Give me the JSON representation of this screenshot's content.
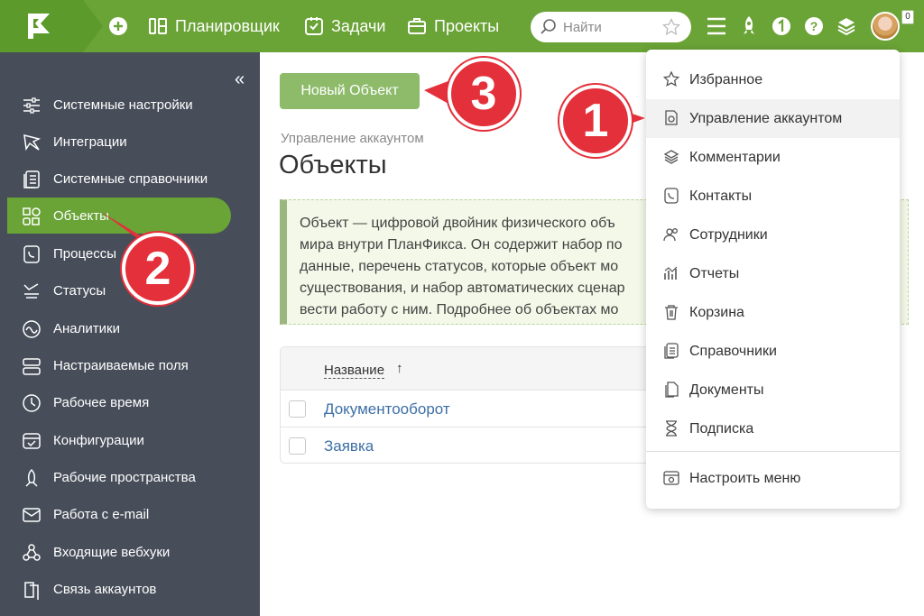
{
  "topbar": {
    "nav": [
      {
        "label": "Планировщик",
        "icon": "calendar-icon"
      },
      {
        "label": "Задачи",
        "icon": "task-check-icon"
      },
      {
        "label": "Проекты",
        "icon": "briefcase-icon"
      }
    ],
    "search_placeholder": "Найти",
    "notification_count": "0"
  },
  "sidebar": {
    "items": [
      {
        "label": "Системные настройки",
        "icon": "sliders-icon"
      },
      {
        "label": "Интеграции",
        "icon": "integration-icon"
      },
      {
        "label": "Системные справочники",
        "icon": "directory-icon"
      },
      {
        "label": "Объекты",
        "icon": "objects-icon",
        "active": true
      },
      {
        "label": "Процессы",
        "icon": "process-icon"
      },
      {
        "label": "Статусы",
        "icon": "status-icon"
      },
      {
        "label": "Аналитики",
        "icon": "analytics-icon"
      },
      {
        "label": "Настраиваемые поля",
        "icon": "custom-fields-icon"
      },
      {
        "label": "Рабочее время",
        "icon": "clock-icon"
      },
      {
        "label": "Конфигурации",
        "icon": "config-icon"
      },
      {
        "label": "Рабочие пространства",
        "icon": "rocket-icon"
      },
      {
        "label": "Работа с e-mail",
        "icon": "mail-icon"
      },
      {
        "label": "Входящие вебхуки",
        "icon": "webhook-icon"
      },
      {
        "label": "Связь аккаунтов",
        "icon": "link-accounts-icon"
      }
    ]
  },
  "main": {
    "new_button": "Новый Объект",
    "breadcrumb": "Управление аккаунтом",
    "title": "Объекты",
    "info_lines": [
      "Объект — цифровой двойник физического объ",
      "мира внутри ПланФикса. Он содержит набор по",
      "данные, перечень статусов, которые объект мо",
      "существования, и набор автоматических сценар",
      "вести работу с ним. Подробнее об объектах мо"
    ],
    "table": {
      "column": "Название",
      "sort_glyph": "↑",
      "rows": [
        "Документооборот",
        "Заявка"
      ]
    }
  },
  "dropdown": {
    "items": [
      {
        "label": "Избранное",
        "icon": "star-icon"
      },
      {
        "label": "Управление аккаунтом",
        "icon": "account-settings-icon",
        "hover": true
      },
      {
        "label": "Комментарии",
        "icon": "layers-icon"
      },
      {
        "label": "Контакты",
        "icon": "contacts-icon"
      },
      {
        "label": "Сотрудники",
        "icon": "employees-icon"
      },
      {
        "label": "Отчеты",
        "icon": "reports-icon"
      },
      {
        "label": "Корзина",
        "icon": "trash-icon"
      },
      {
        "label": "Справочники",
        "icon": "directories-icon"
      },
      {
        "label": "Документы",
        "icon": "documents-icon"
      },
      {
        "label": "Подписка",
        "icon": "hourglass-icon"
      }
    ],
    "footer_item": {
      "label": "Настроить меню",
      "icon": "menu-settings-icon"
    }
  },
  "callouts": [
    "1",
    "2",
    "3"
  ],
  "colors": {
    "brand_green": "#6aa336",
    "sidebar_bg": "#474d59",
    "callout_red": "#e3303a",
    "link_blue": "#3d6fa6"
  }
}
